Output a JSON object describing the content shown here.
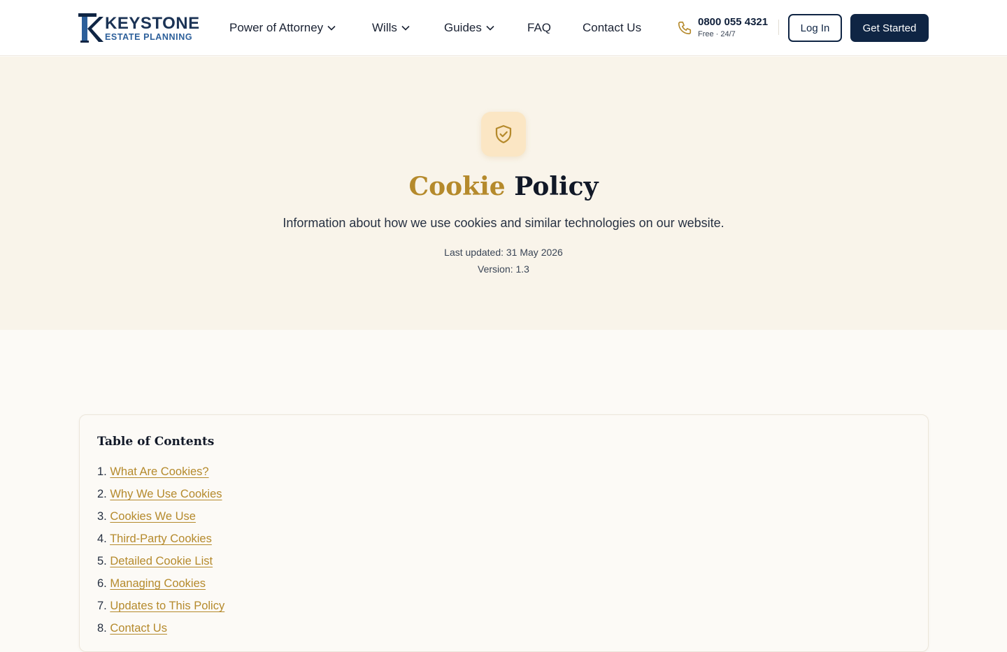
{
  "brand": {
    "name_line1": "KEYSTONE",
    "name_line2": "ESTATE PLANNING",
    "colors": {
      "navy": "#0f2544",
      "gold": "#b58a2c",
      "blue": "#2c5f9a"
    }
  },
  "nav": {
    "items": [
      {
        "label": "Power of Attorney",
        "has_dropdown": true
      },
      {
        "label": "Wills",
        "has_dropdown": true
      },
      {
        "label": "Guides",
        "has_dropdown": true
      },
      {
        "label": "FAQ",
        "has_dropdown": false
      },
      {
        "label": "Contact Us",
        "has_dropdown": false
      }
    ]
  },
  "phone": {
    "number": "0800 055 4321",
    "note": "Free · 24/7",
    "icon": "phone-icon"
  },
  "actions": {
    "login_label": "Log In",
    "start_label": "Get Started"
  },
  "hero": {
    "icon": "shield-check-icon",
    "title_highlight": "Cookie",
    "title_rest": "Policy",
    "description": "Information about how we use cookies and similar technologies on our website.",
    "last_updated": "Last updated: 31 May 2026",
    "version": "Version: 1.3"
  },
  "toc": {
    "title": "Table of Contents",
    "items": [
      {
        "num": "1.",
        "label": "What Are Cookies?"
      },
      {
        "num": "2.",
        "label": "Why We Use Cookies"
      },
      {
        "num": "3.",
        "label": "Cookies We Use"
      },
      {
        "num": "4.",
        "label": "Third-Party Cookies"
      },
      {
        "num": "5.",
        "label": "Detailed Cookie List"
      },
      {
        "num": "6.",
        "label": "Managing Cookies"
      },
      {
        "num": "7.",
        "label": "Updates to This Policy"
      },
      {
        "num": "8.",
        "label": "Contact Us"
      }
    ]
  }
}
